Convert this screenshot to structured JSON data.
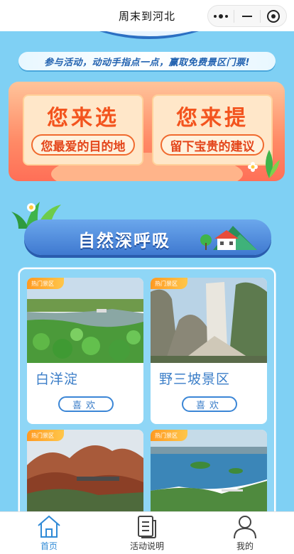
{
  "window": {
    "title": "周末到河北",
    "capsule_icons": [
      "more-dots-icon",
      "minimize-icon",
      "target-close-icon"
    ]
  },
  "banner": {
    "slogan": "参与活动，动动手指点一点，赢取免费景区门票!"
  },
  "promo": {
    "left_heading": "您来选",
    "left_sub": "您最爱的目的地",
    "right_heading": "您来提",
    "right_sub": "留下宝贵的建议"
  },
  "section": {
    "title": "自然深呼吸"
  },
  "cards": [
    {
      "tag": "热门景区",
      "name": "白洋淀",
      "like": "喜欢"
    },
    {
      "tag": "热门景区",
      "name": "野三坡景区",
      "like": "喜欢"
    },
    {
      "tag": "热门景区",
      "name": "",
      "like": ""
    },
    {
      "tag": "热门景区",
      "name": "",
      "like": ""
    }
  ],
  "tabbar": {
    "items": [
      {
        "label": "首页",
        "icon": "home-icon",
        "active": true
      },
      {
        "label": "活动说明",
        "icon": "document-icon",
        "active": false
      },
      {
        "label": "我的",
        "icon": "user-icon",
        "active": false
      }
    ],
    "active_color": "#2f8ad6"
  },
  "colors": {
    "background": "#7fd0f4",
    "accent_blue": "#3b7ec8",
    "promo_orange": "#f3541e"
  }
}
